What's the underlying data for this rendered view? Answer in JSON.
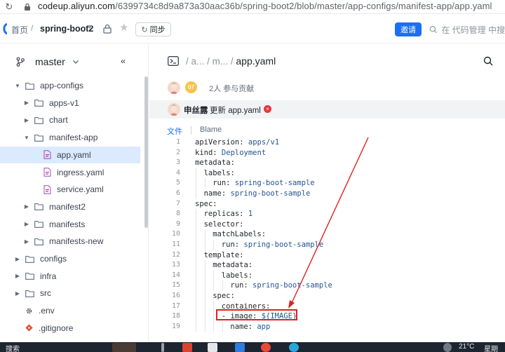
{
  "browser": {
    "url_host": "codeup.aliyun.com",
    "url_path": "/6399734c8d9a873a30aac36b/spring-boot2/blob/master/app-configs/manifest-app/app.yaml"
  },
  "header": {
    "home": "首页",
    "separator": "/",
    "repo": "spring-boot2",
    "sync_label": "同步",
    "invite_label": "邀请",
    "search_placeholder": "在 代码管理 中搜"
  },
  "sidebar": {
    "branch": "master",
    "collapse": "‹‹",
    "tree": [
      {
        "label": "app-configs",
        "type": "folder",
        "expanded": true,
        "depth": 0
      },
      {
        "label": "apps-v1",
        "type": "folder",
        "expanded": false,
        "depth": 1
      },
      {
        "label": "chart",
        "type": "folder",
        "expanded": false,
        "depth": 1
      },
      {
        "label": "manifest-app",
        "type": "folder",
        "expanded": true,
        "depth": 1
      },
      {
        "label": "app.yaml",
        "type": "file",
        "depth": 2,
        "active": true
      },
      {
        "label": "ingress.yaml",
        "type": "file",
        "depth": 2
      },
      {
        "label": "service.yaml",
        "type": "file",
        "depth": 2
      },
      {
        "label": "manifest2",
        "type": "folder",
        "expanded": false,
        "depth": 1
      },
      {
        "label": "manifests",
        "type": "folder",
        "expanded": false,
        "depth": 1
      },
      {
        "label": "manifests-new",
        "type": "folder",
        "expanded": false,
        "depth": 1
      },
      {
        "label": "configs",
        "type": "folder",
        "expanded": false,
        "depth": 0
      },
      {
        "label": "infra",
        "type": "folder",
        "expanded": false,
        "depth": 0
      },
      {
        "label": "src",
        "type": "folder",
        "expanded": false,
        "depth": 0
      },
      {
        "label": ".env",
        "type": "gear",
        "depth": 0
      },
      {
        "label": ".gitignore",
        "type": "git",
        "depth": 0
      }
    ]
  },
  "main": {
    "path_parts": [
      "a...",
      "/",
      "m...",
      "/"
    ],
    "file_name": "app.yaml",
    "contributor_count_badge": "07",
    "contributors_text": "2人 参与贡献",
    "commit_author": "申丝露",
    "commit_message": "更新 app.yaml",
    "commit_status": "×",
    "tabs": [
      "文件",
      "Blame"
    ]
  },
  "code": [
    {
      "n": "1",
      "key": "apiVersion:",
      "val": " apps/v1",
      "indent": 0
    },
    {
      "n": "2",
      "key": "kind:",
      "val": " Deployment",
      "indent": 0
    },
    {
      "n": "3",
      "key": "metadata:",
      "val": "",
      "indent": 0
    },
    {
      "n": "4",
      "key": "labels:",
      "val": "",
      "indent": 1
    },
    {
      "n": "5",
      "key": "run:",
      "val": " spring-boot-sample",
      "indent": 2
    },
    {
      "n": "6",
      "key": "name:",
      "val": " spring-boot-sample",
      "indent": 1
    },
    {
      "n": "7",
      "key": "spec:",
      "val": "",
      "indent": 0
    },
    {
      "n": "8",
      "key": "replicas:",
      "val": " 1",
      "indent": 1
    },
    {
      "n": "9",
      "key": "selector:",
      "val": "",
      "indent": 1
    },
    {
      "n": "10",
      "key": "matchLabels:",
      "val": "",
      "indent": 2
    },
    {
      "n": "11",
      "key": "run:",
      "val": " spring-boot-sample",
      "indent": 3
    },
    {
      "n": "12",
      "key": "template:",
      "val": "",
      "indent": 1
    },
    {
      "n": "13",
      "key": "metadata:",
      "val": "",
      "indent": 2
    },
    {
      "n": "14",
      "key": "labels:",
      "val": "",
      "indent": 3
    },
    {
      "n": "15",
      "key": "run:",
      "val": " spring-boot-sample",
      "indent": 4
    },
    {
      "n": "16",
      "key": "spec:",
      "val": "",
      "indent": 2
    },
    {
      "n": "17",
      "key": "containers:",
      "val": "",
      "indent": 3
    },
    {
      "n": "18",
      "key": "- image:",
      "val": " ${IMAGE}",
      "indent": 3
    },
    {
      "n": "19",
      "key": "name:",
      "val": " app",
      "indent": 4
    }
  ],
  "taskbar": {
    "search_text": "搜索",
    "weather": "21°C",
    "clock": "星期"
  },
  "colors": {
    "accent": "#1b6ff5",
    "annotation_red": "#e02020",
    "selected_row": "#dbeafd"
  }
}
